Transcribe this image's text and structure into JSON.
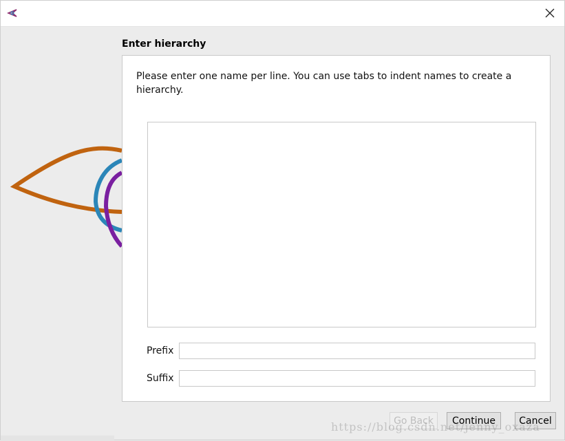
{
  "window": {
    "close_symbol": "✕",
    "app_icon": "maya-style-logo-icon"
  },
  "page": {
    "heading": "Enter hierarchy",
    "instructions": "Please enter one name per line. You can use tabs to indent names to create a hierarchy."
  },
  "form": {
    "names_value": "",
    "prefix_label": "Prefix",
    "prefix_value": "",
    "suffix_label": "Suffix",
    "suffix_value": ""
  },
  "buttons": {
    "back": "Go Back",
    "continue": "Continue",
    "cancel": "Cancel"
  },
  "watermark": "https://blog.csdn.net/jenny_oxaza",
  "colors": {
    "orange_curve": "#c0630f",
    "blue_curve": "#2b86b8",
    "purple_curve": "#7a1fa0"
  }
}
